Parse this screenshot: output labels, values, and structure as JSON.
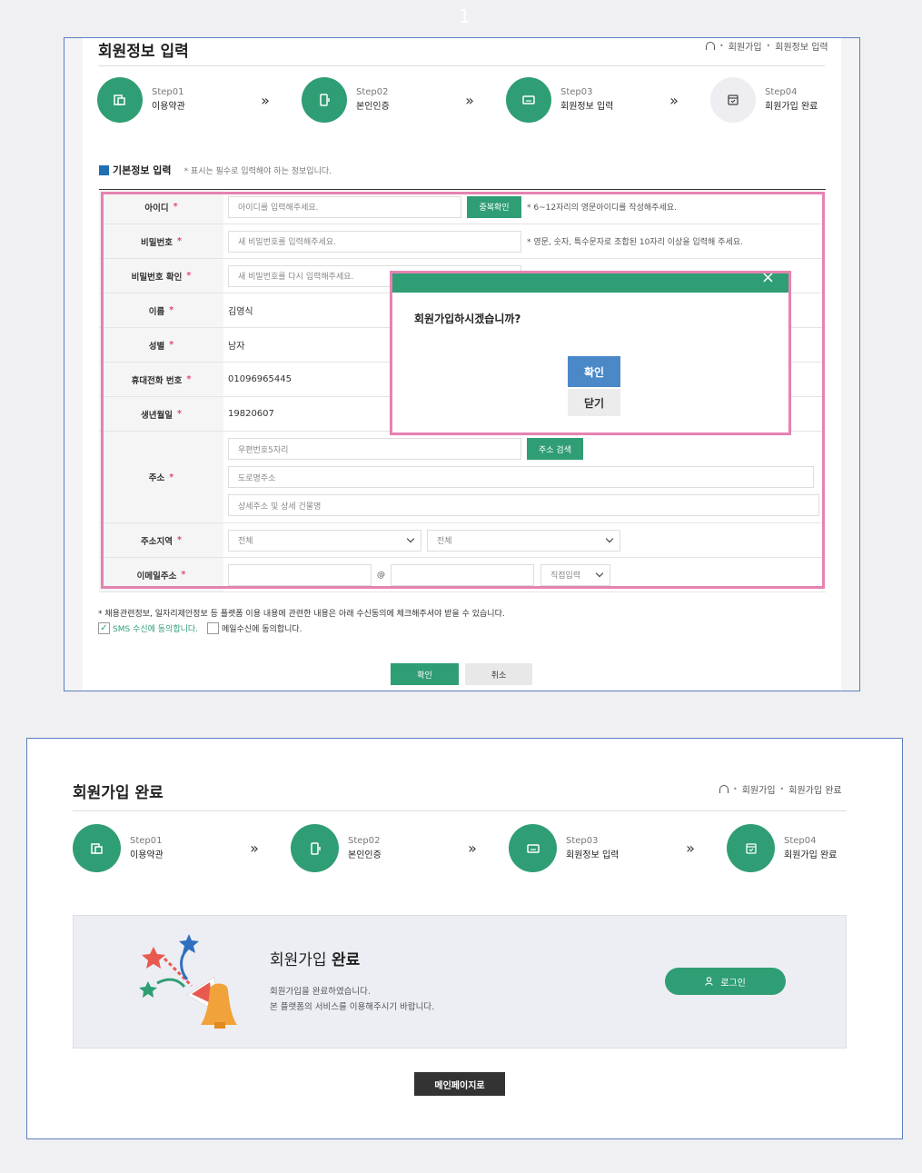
{
  "page_number": "1",
  "panel1": {
    "title": "회원정보 입력",
    "breadcrumb": [
      "회원가입",
      "회원정보 입력"
    ],
    "steps": [
      {
        "no": "Step01",
        "label": "이용약관",
        "active": true,
        "icon": "document-copy-icon"
      },
      {
        "no": "Step02",
        "label": "본인인증",
        "active": true,
        "icon": "phone-icon"
      },
      {
        "no": "Step03",
        "label": "회원정보 입력",
        "active": true,
        "icon": "id-card-icon"
      },
      {
        "no": "Step04",
        "label": "회원가입 완료",
        "active": false,
        "icon": "calendar-check-icon"
      }
    ],
    "step_arrow": "»",
    "section_title": "기본정보 입력",
    "section_note": "* 표시는 필수로 입력해야 하는 정보입니다.",
    "required_mark": "*",
    "fields": {
      "id": {
        "label": "아이디",
        "placeholder": "아이디를 입력해주세요.",
        "button": "중복확인",
        "hint": "* 6~12자리의 영문아이디를 작성해주세요."
      },
      "password": {
        "label": "비밀번호",
        "placeholder": "새 비밀번호를 입력해주세요.",
        "hint": "* 영문, 숫자, 특수문자로 조합된 10자리 이상을 입력해 주세요."
      },
      "password_confirm": {
        "label": "비밀번호 확인",
        "placeholder": "새 비밀번호를 다시 입력해주세요."
      },
      "name": {
        "label": "이름",
        "value": "김영식"
      },
      "gender": {
        "label": "성별",
        "value": "남자"
      },
      "phone": {
        "label": "휴대전화 번호",
        "value": "01096965445"
      },
      "birth": {
        "label": "생년월일",
        "value": "19820607"
      },
      "address": {
        "label": "주소",
        "zip_placeholder": "우편번호5자리",
        "search_button": "주소 검색",
        "road_placeholder": "도로명주소",
        "detail_placeholder": "상세주소 및 상세 건물명"
      },
      "region": {
        "label": "주소지역",
        "select1": "전체",
        "select2": "전체"
      },
      "email": {
        "label": "이메일주소",
        "at": "@",
        "domain_select": "직접입력"
      }
    },
    "dialog": {
      "message": "회원가입하시겠습니까?",
      "ok": "확인",
      "close": "닫기",
      "close_icon": "×"
    },
    "consent_note": "* 채용관련정보, 일자리제안정보 등 플랫폼 이용 내용에 관련한 내용은 아래 수신동의에 체크해주셔야 받을 수 있습니다.",
    "consent_sms": {
      "label": "SMS 수신에 동의합니다.",
      "checked": true
    },
    "consent_mail": {
      "label": "메일수신에 동의합니다.",
      "checked": false
    },
    "confirm_button": "확인",
    "cancel_button": "취소"
  },
  "panel2": {
    "title": "회원가입 완료",
    "breadcrumb": [
      "회원가입",
      "회원가입 완료"
    ],
    "steps": [
      {
        "no": "Step01",
        "label": "이용약관",
        "active": true
      },
      {
        "no": "Step02",
        "label": "본인인증",
        "active": true
      },
      {
        "no": "Step03",
        "label": "회원정보 입력",
        "active": true
      },
      {
        "no": "Step04",
        "label": "회원가입 완료",
        "active": true
      }
    ],
    "done_title_prefix": "회원가입 ",
    "done_title_bold": "완료",
    "done_desc1": "회원가입을 완료하였습니다.",
    "done_desc2": "본 플랫폼의 서비스를 이용해주시기 바랍니다.",
    "login_button": "로그인",
    "main_button": "메인페이지로"
  },
  "colors": {
    "brand_green": "#2f9e74",
    "highlight_pink": "#e583b0",
    "dialog_ok_blue": "#4a88c7",
    "frame_blue": "#5b7fbf"
  }
}
